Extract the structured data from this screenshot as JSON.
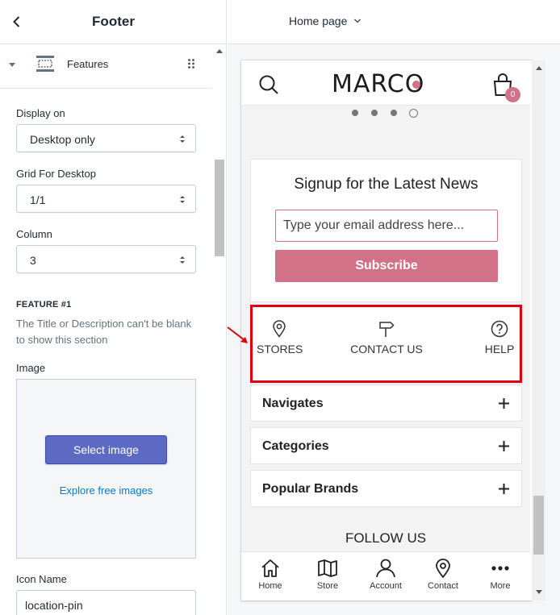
{
  "editor": {
    "title": "Footer",
    "section_label": "Features",
    "display_on": {
      "label": "Display on",
      "value": "Desktop only"
    },
    "grid": {
      "label": "Grid For Desktop",
      "value": "1/1"
    },
    "column": {
      "label": "Column",
      "value": "3"
    },
    "feature_heading": "FEATURE #1",
    "feature_help": "The Title or Description can't be blank to show this section",
    "image": {
      "label": "Image",
      "select_button": "Select image",
      "explore_link": "Explore free images"
    },
    "icon_name": {
      "label": "Icon Name",
      "value": "location-pin"
    }
  },
  "preview": {
    "page_selector": "Home page",
    "logo": "MARCO",
    "cart_count": "0",
    "slider_dots": 4,
    "slider_active_index": 3,
    "newsletter": {
      "heading": "Signup for the Latest News",
      "placeholder": "Type your email address here...",
      "button": "Subscribe"
    },
    "features": [
      {
        "icon": "location-pin-icon",
        "label": "STORES"
      },
      {
        "icon": "signpost-icon",
        "label": "CONTACT US"
      },
      {
        "icon": "question-circle-icon",
        "label": "HELP"
      }
    ],
    "accordions": [
      "Navigates",
      "Categories",
      "Popular Brands"
    ],
    "follow_us": "FOLLOW US",
    "bottom_nav": [
      {
        "icon": "home-icon",
        "label": "Home"
      },
      {
        "icon": "map-icon",
        "label": "Store"
      },
      {
        "icon": "user-icon",
        "label": "Account"
      },
      {
        "icon": "location-pin-icon",
        "label": "Contact"
      },
      {
        "icon": "more-dots-icon",
        "label": "More"
      }
    ]
  },
  "colors": {
    "accent": "#d17288",
    "primary_button": "#5c6ac4",
    "link": "#007ace",
    "highlight": "#e0000e"
  }
}
